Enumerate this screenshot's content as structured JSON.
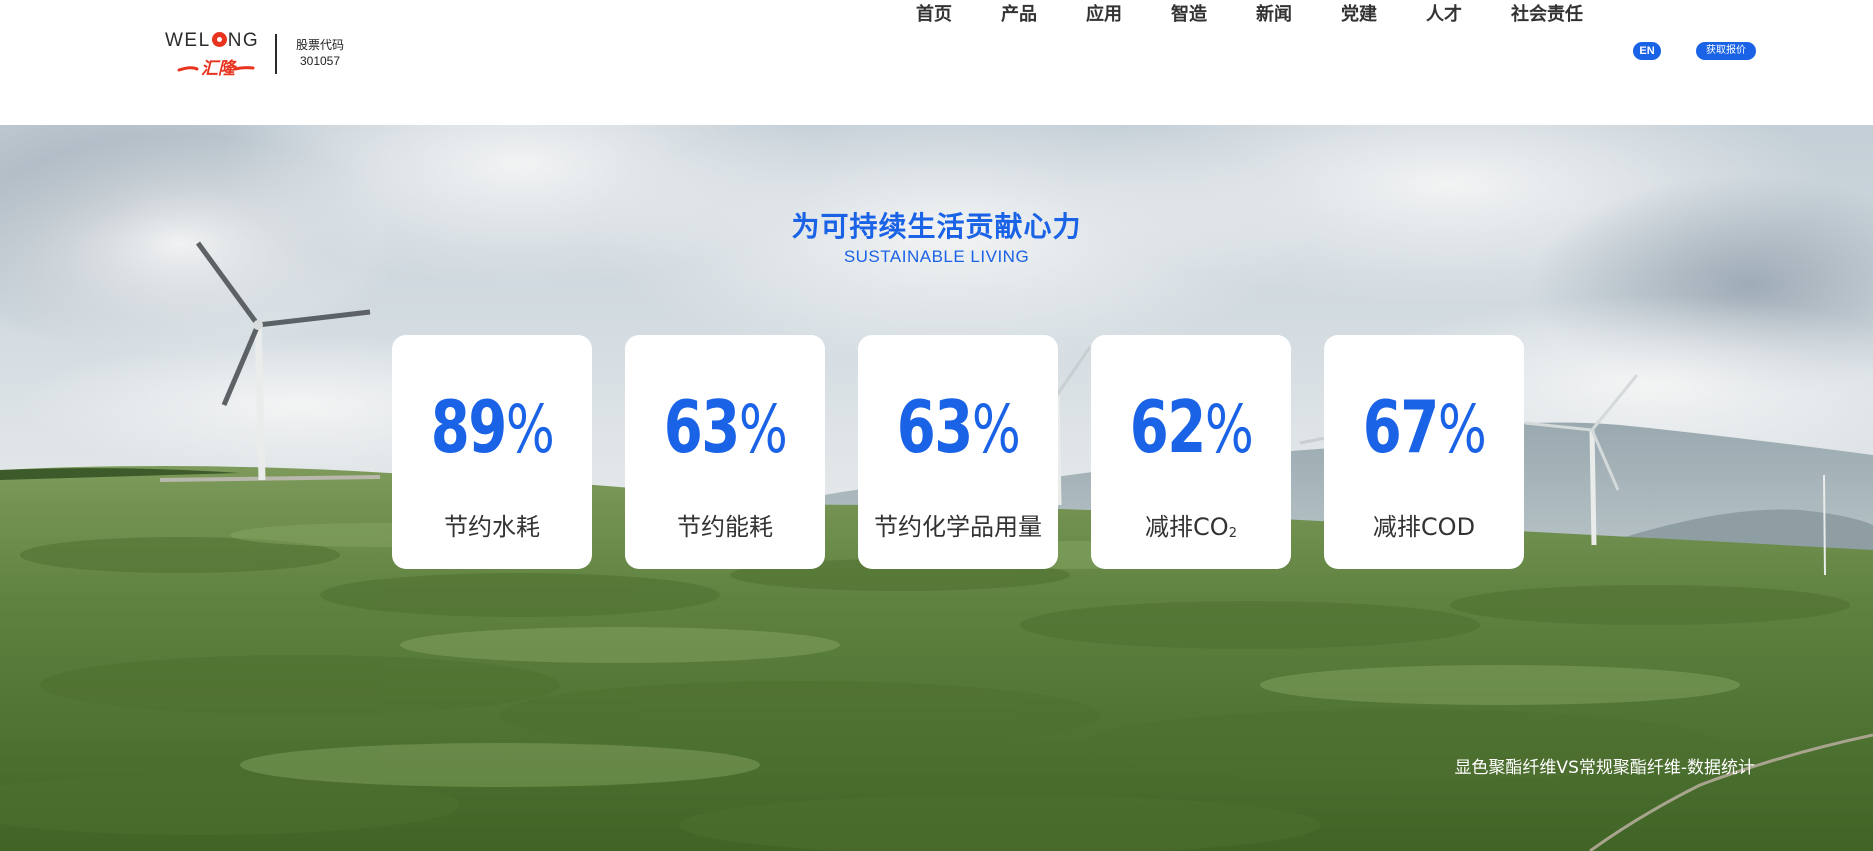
{
  "brand": {
    "logo_text_prefix": "WEL",
    "logo_text_suffix": "NG",
    "logo_mark_text": "汇隆",
    "stock_label": "股票代码",
    "stock_code": "301057",
    "accent_color": "#1a62e6",
    "logo_red": "#e8331f"
  },
  "nav": {
    "items": [
      {
        "label": "首页"
      },
      {
        "label": "产品"
      },
      {
        "label": "应用"
      },
      {
        "label": "智造"
      },
      {
        "label": "新闻"
      },
      {
        "label": "党建"
      },
      {
        "label": "人才"
      },
      {
        "label": "社会责任"
      }
    ],
    "lang_label": "EN",
    "quote_label": "获取报价"
  },
  "hero": {
    "title": "为可持续生活贡献心力",
    "subtitle": "SUSTAINABLE LIVING",
    "caption": "显色聚酯纤维VS常规聚酯纤维-数据统计",
    "stats": [
      {
        "value": "89",
        "unit": "%",
        "label": "节约水耗",
        "label_sub": ""
      },
      {
        "value": "63",
        "unit": "%",
        "label": "节约能耗",
        "label_sub": ""
      },
      {
        "value": "63",
        "unit": "%",
        "label": "节约化学品用量",
        "label_sub": ""
      },
      {
        "value": "62",
        "unit": "%",
        "label": "减排CO",
        "label_sub": "2"
      },
      {
        "value": "67",
        "unit": "%",
        "label": "减排COD",
        "label_sub": ""
      }
    ]
  }
}
